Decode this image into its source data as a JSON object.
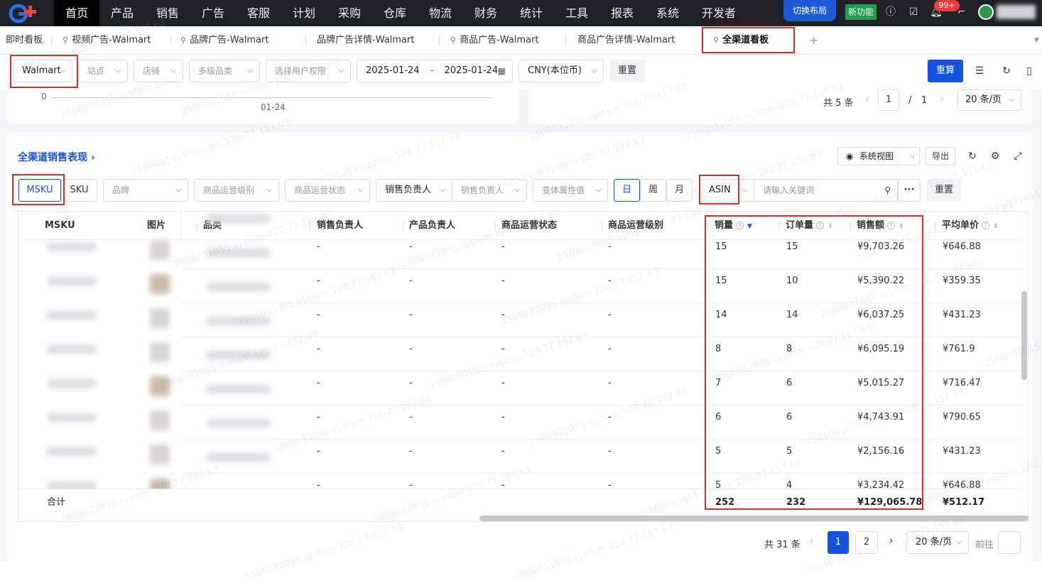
{
  "nav": {
    "items": [
      "首页",
      "产品",
      "销售",
      "广告",
      "客服",
      "计划",
      "采购",
      "仓库",
      "物流",
      "财务",
      "统计",
      "工具",
      "报表",
      "系统",
      "开发者"
    ],
    "switch_layout": "切换布局",
    "new_feature": "新功能",
    "notif_count": "99+"
  },
  "tabs": {
    "items": [
      "即时看板",
      "视频广告-Walmart",
      "品牌广告-Walmart",
      "品牌广告详情-Walmart",
      "商品广告-Walmart",
      "商品广告详情-Walmart",
      "全渠道看板"
    ],
    "add": "+"
  },
  "filters": {
    "platform": "Walmart",
    "site": "站点",
    "store": "店铺",
    "category": "多级品类",
    "permission": "选择用户权限",
    "date_start": "2025-01-24",
    "date_sep": "-",
    "date_end": "2025-01-24",
    "currency": "CNY(本位币)",
    "reset": "重置",
    "recalc": "重算"
  },
  "upper_cards": {
    "axis_zero": "0",
    "axis_date": "01-24",
    "pager_total": "共 5 条",
    "pager_page": "1",
    "pager_slash": "/",
    "pager_pages": "1",
    "pager_size": "20 条/页"
  },
  "section": {
    "title": "全渠道销售表现 ›",
    "view": "系统视图",
    "export": "导出"
  },
  "table_filters": {
    "msku": "MSKU",
    "sku": "SKU",
    "brand": "品牌",
    "op_level": "商品运营级别",
    "op_status": "商品运营状态",
    "sales_owner_type": "销售负责人",
    "sales_owner": "销售负责人",
    "variant": "变体属性值",
    "day": "日",
    "week": "周",
    "month": "月",
    "asin": "ASIN",
    "keyword_placeholder": "请输入关键词",
    "more": "···",
    "reset": "重置"
  },
  "table": {
    "headers": [
      "MSKU",
      "图片",
      "品类",
      "销售负责人",
      "产品负责人",
      "商品运营状态",
      "商品运营级别",
      "销量",
      "订单量",
      "销售额",
      "平均单价"
    ],
    "rows": [
      {
        "c1": "-",
        "c2": "-",
        "c3": "-",
        "c4": "-",
        "qty": "15",
        "orders": "15",
        "amount": "¥9,703.26",
        "avg": "¥646.88"
      },
      {
        "c1": "-",
        "c2": "-",
        "c3": "-",
        "c4": "-",
        "qty": "15",
        "orders": "10",
        "amount": "¥5,390.22",
        "avg": "¥359.35"
      },
      {
        "c1": "-",
        "c2": "-",
        "c3": "-",
        "c4": "-",
        "qty": "14",
        "orders": "14",
        "amount": "¥6,037.25",
        "avg": "¥431.23"
      },
      {
        "c1": "-",
        "c2": "-",
        "c3": "-",
        "c4": "-",
        "qty": "8",
        "orders": "8",
        "amount": "¥6,095.19",
        "avg": "¥761.9"
      },
      {
        "c1": "-",
        "c2": "-",
        "c3": "-",
        "c4": "-",
        "qty": "7",
        "orders": "6",
        "amount": "¥5,015.27",
        "avg": "¥716.47"
      },
      {
        "c1": "-",
        "c2": "-",
        "c3": "-",
        "c4": "-",
        "qty": "6",
        "orders": "6",
        "amount": "¥4,743.91",
        "avg": "¥790.65"
      },
      {
        "c1": "-",
        "c2": "-",
        "c3": "-",
        "c4": "-",
        "qty": "5",
        "orders": "5",
        "amount": "¥2,156.16",
        "avg": "¥431.23"
      },
      {
        "c1": "-",
        "c2": "-",
        "c3": "-",
        "c4": "-",
        "qty": "5",
        "orders": "4",
        "amount": "¥3,234.42",
        "avg": "¥646.88"
      }
    ],
    "total": {
      "label": "合计",
      "qty": "252",
      "orders": "232",
      "amount": "¥129,065.78",
      "avg": "¥512.17"
    }
  },
  "pagination": {
    "total": "共 31 条",
    "prev": "‹",
    "page1": "1",
    "page2": "2",
    "next": "›",
    "size": "20 条/页",
    "goto": "前往"
  },
  "watermark": "2506031055 system 120.77.157.63"
}
